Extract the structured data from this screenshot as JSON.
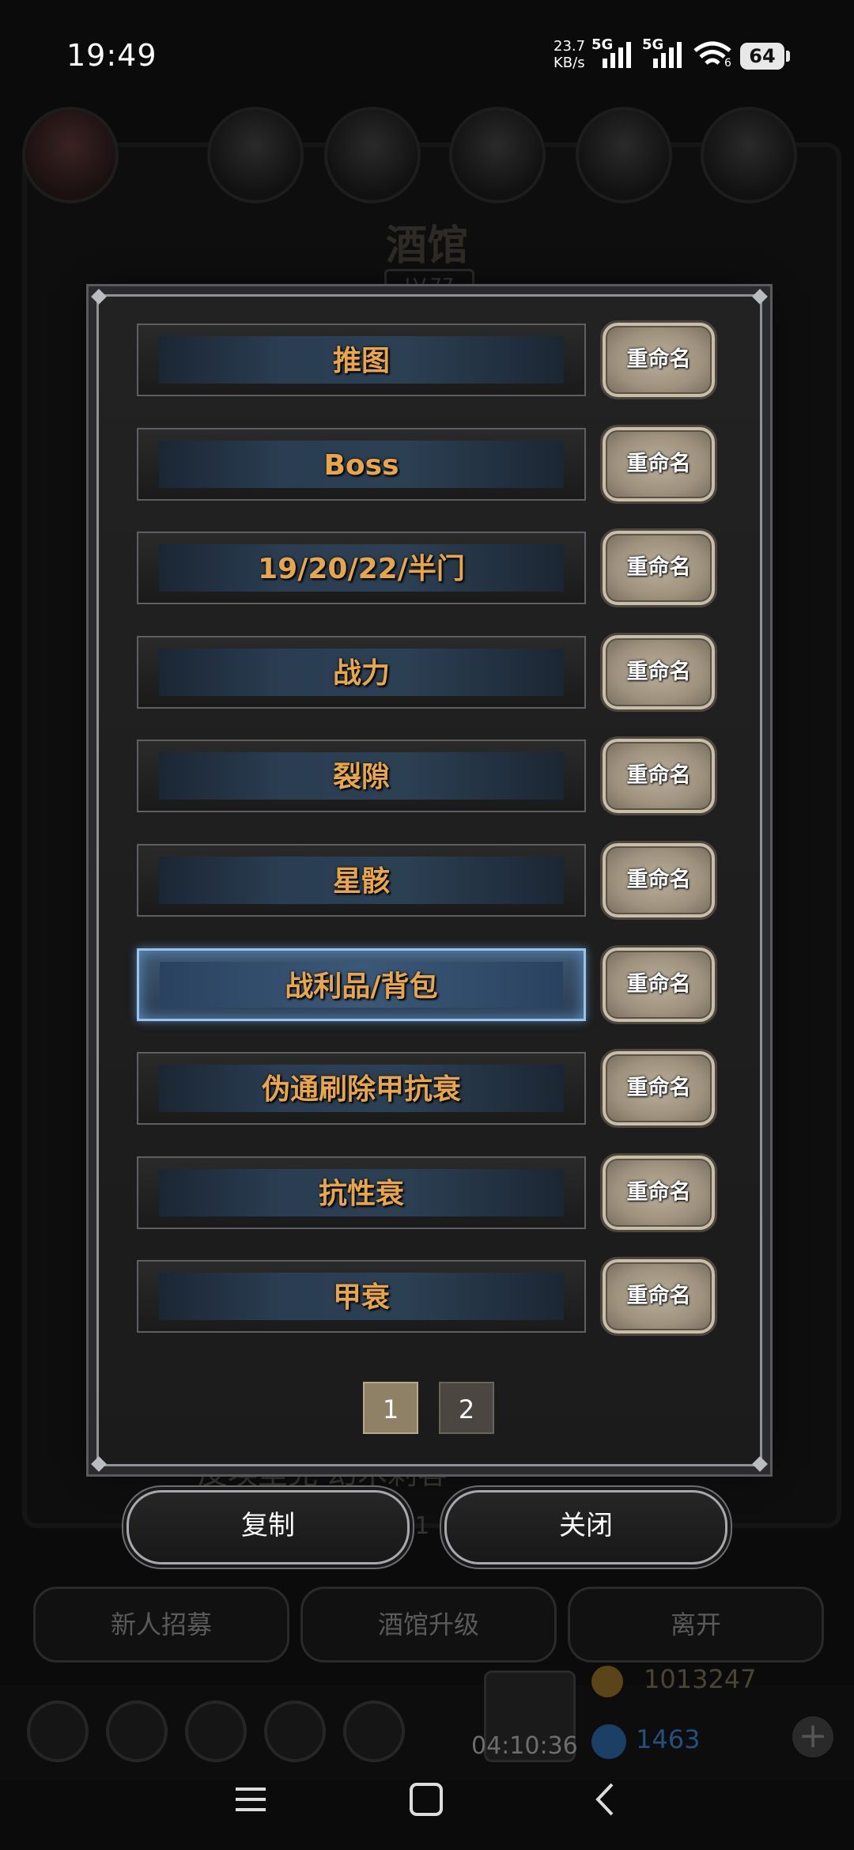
{
  "status_bar": {
    "time": "19:49",
    "net_speed_value": "23.7",
    "net_speed_unit": "KB/s",
    "network_1": "5G",
    "network_2": "5G",
    "wifi_level": "6",
    "battery": "64"
  },
  "background": {
    "title": "酒馆",
    "level": "LV.77",
    "hero_name": "皮埃里克·幻术刺客",
    "hero_timer": "0:1",
    "buttons": [
      "新人招募",
      "酒馆升级",
      "离开"
    ],
    "chest_timer": "04:10:36",
    "gold": "1013247",
    "gems": "1463"
  },
  "dialog": {
    "rows": [
      {
        "name": "推图",
        "rename": "重命名",
        "selected": false
      },
      {
        "name": "Boss",
        "rename": "重命名",
        "selected": false
      },
      {
        "name": "19/20/22/半门",
        "rename": "重命名",
        "selected": false
      },
      {
        "name": "战力",
        "rename": "重命名",
        "selected": false
      },
      {
        "name": "裂隙",
        "rename": "重命名",
        "selected": false
      },
      {
        "name": "星骸",
        "rename": "重命名",
        "selected": false
      },
      {
        "name": "战利品/背包",
        "rename": "重命名",
        "selected": true
      },
      {
        "name": "伪通刷除甲抗衰",
        "rename": "重命名",
        "selected": false
      },
      {
        "name": "抗性衰",
        "rename": "重命名",
        "selected": false
      },
      {
        "name": "甲衰",
        "rename": "重命名",
        "selected": false
      }
    ],
    "pages": [
      "1",
      "2"
    ],
    "current_page": "1"
  },
  "actions": {
    "copy": "复制",
    "close": "关闭"
  },
  "colors": {
    "name_text": "#e8a64a",
    "selected_border": "#9cc2e8"
  }
}
